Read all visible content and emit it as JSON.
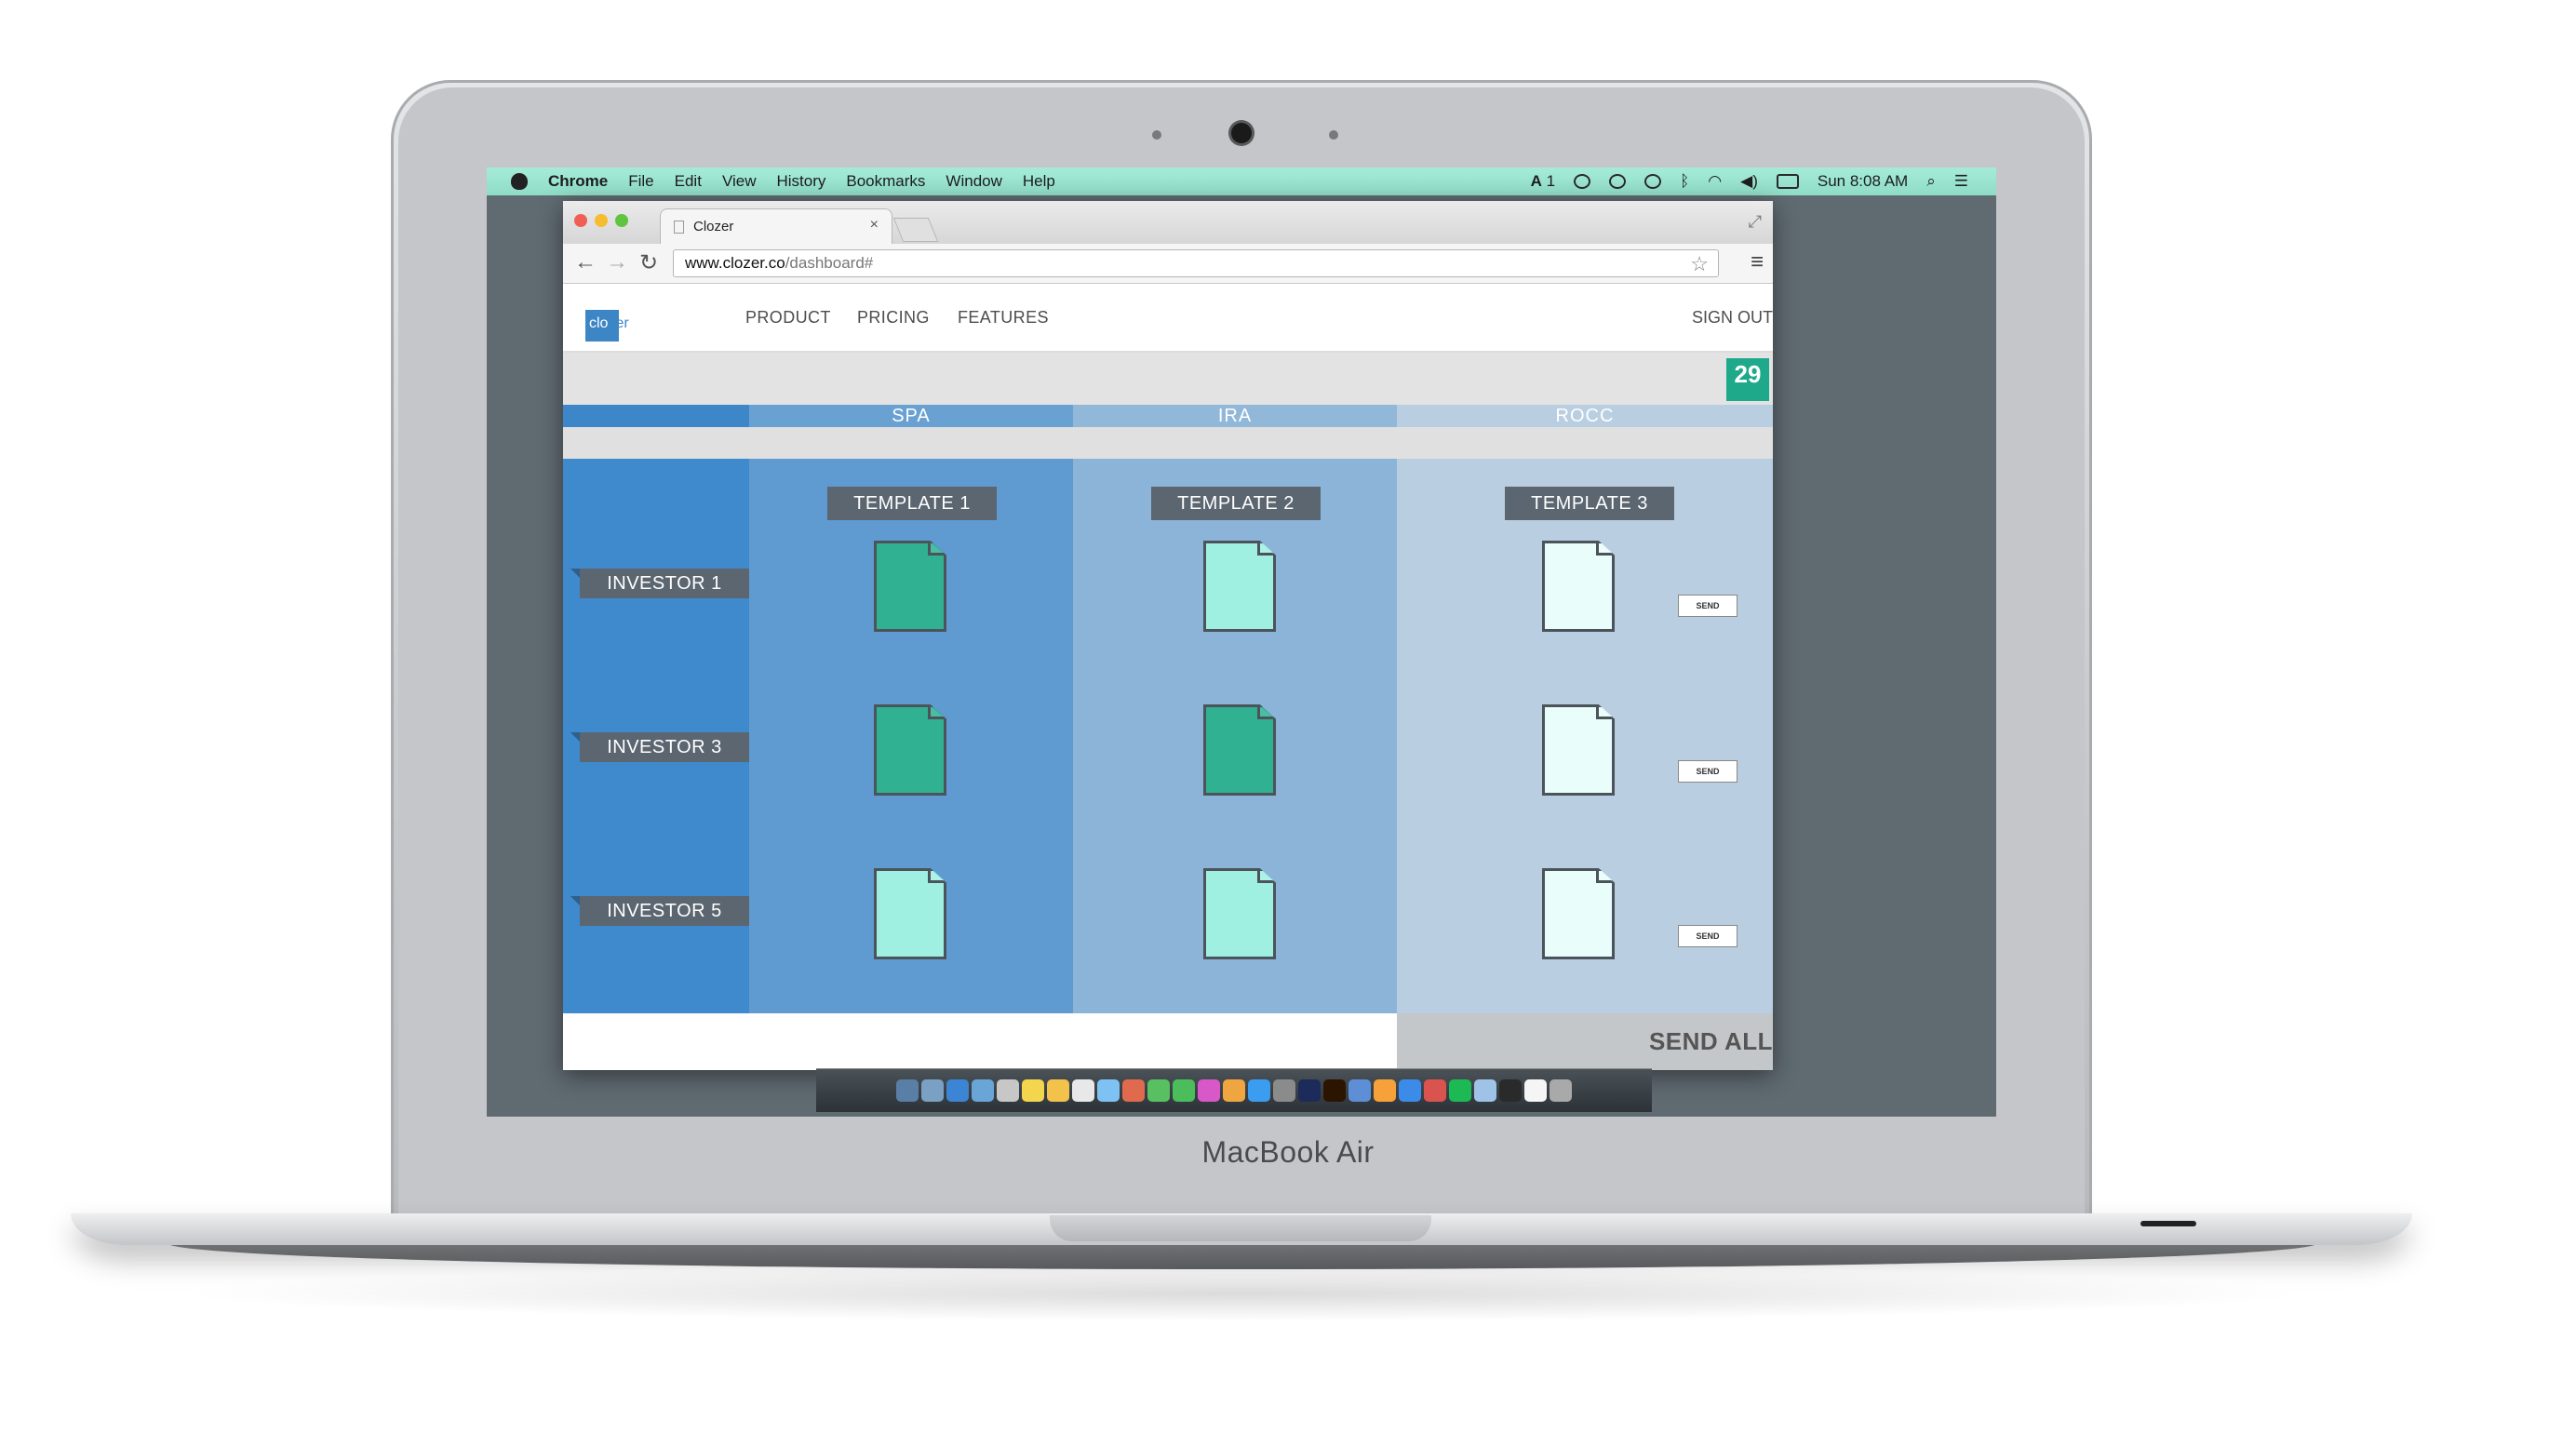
{
  "device": {
    "label": "MacBook Air"
  },
  "menubar": {
    "app": "Chrome",
    "items": [
      "File",
      "Edit",
      "View",
      "History",
      "Bookmarks",
      "Window",
      "Help"
    ],
    "status_count": "1",
    "clock": "Sun 8:08 AM"
  },
  "browser": {
    "tab_title": "Clozer",
    "url_host": "www.clozer.co",
    "url_path": "/dashboard#"
  },
  "site": {
    "logo_main": "clo",
    "logo_tail": "zer",
    "nav": [
      "PRODUCT",
      "PRICING",
      "FEATURES"
    ],
    "sign_out": "SIGN OUT",
    "date_day": "29",
    "columns": [
      {
        "name": "SPA",
        "template": "TEMPLATE 1"
      },
      {
        "name": "IRA",
        "template": "TEMPLATE 2"
      },
      {
        "name": "ROCC",
        "template": "TEMPLATE 3"
      }
    ],
    "investors": [
      "INVESTOR 1",
      "INVESTOR 3",
      "INVESTOR 5"
    ],
    "doc_status": [
      [
        "complete",
        "pending",
        "empty"
      ],
      [
        "complete",
        "complete",
        "empty"
      ],
      [
        "pending",
        "pending",
        "empty"
      ]
    ],
    "send_label": "SEND",
    "send_all": "SEND ALL"
  },
  "colors": {
    "complete": "#2fb192",
    "pending": "#a0f0e2",
    "empty": "#e9fdfb",
    "col_spa": "#5f9bd1",
    "col_ira": "#8cb3d8",
    "col_rocc": "#b9cee0",
    "menubar": "#9fe6d2"
  },
  "dock": {
    "icons": [
      "finder-icon",
      "launchpad-icon",
      "safari-icon",
      "mail-icon",
      "contacts-icon",
      "calendar-icon",
      "notes-icon",
      "reminders-icon",
      "maps-icon",
      "photos-icon",
      "messages-icon",
      "facetime-icon",
      "itunes-icon",
      "ibooks-icon",
      "appstore-icon",
      "preferences-icon",
      "photoshop-icon",
      "illustrator-icon",
      "xcode-icon",
      "pages-icon",
      "keynote-icon",
      "chrome-icon",
      "spotify-icon",
      "preview-icon",
      "terminal-icon",
      "textedit-icon",
      "trash-icon"
    ]
  }
}
